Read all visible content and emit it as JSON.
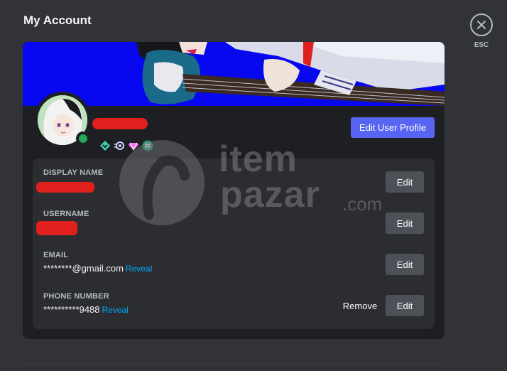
{
  "page": {
    "title": "My Account"
  },
  "close": {
    "label": "ESC",
    "icon": "close-icon"
  },
  "profile": {
    "edit_profile_label": "Edit User Profile",
    "status_color": "#23a55a",
    "banner_color": "#0808f0",
    "badges": [
      "hypesquad-icon",
      "nitro-icon",
      "boost-icon",
      "hashtag-icon"
    ]
  },
  "fields": [
    {
      "label": "DISPLAY NAME",
      "value": "",
      "reveal": "",
      "edit": "Edit"
    },
    {
      "label": "USERNAME",
      "value": "",
      "reveal": "",
      "edit": "Edit"
    },
    {
      "label": "EMAIL",
      "value": "********@gmail.com",
      "reveal": "Reveal",
      "edit": "Edit"
    },
    {
      "label": "PHONE NUMBER",
      "value": "**********9488",
      "reveal": "Reveal",
      "edit": "Edit",
      "remove": "Remove"
    }
  ],
  "watermark": {
    "line1": "item",
    "line2": "pazar",
    "suffix": ".com"
  },
  "colors": {
    "accent": "#5865f2",
    "link": "#00a8fc",
    "redaction": "#e0201c"
  }
}
